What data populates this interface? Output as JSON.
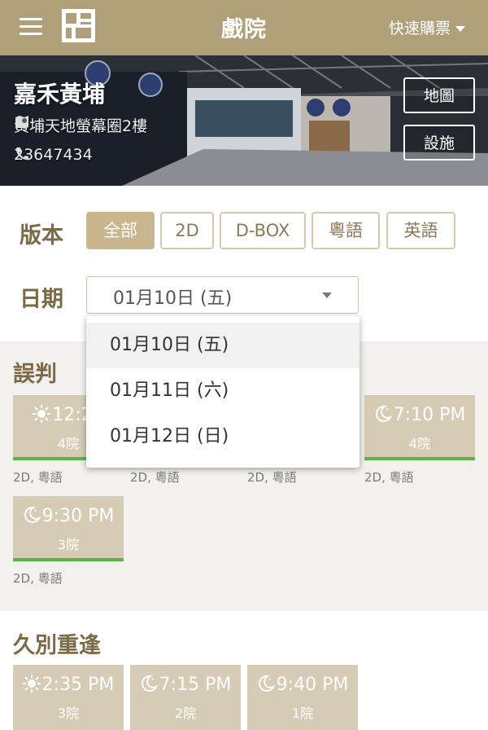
{
  "header": {
    "title": "戲院",
    "quick_buy": "快速購票"
  },
  "cinema": {
    "name": "嘉禾黃埔",
    "address": "黃埔天地螢幕圈2樓",
    "phone": "23647434",
    "map_button": "地圖",
    "facilities_button": "設施"
  },
  "filters": {
    "version_label": "版本",
    "versions": [
      "全部",
      "2D",
      "D-BOX",
      "粵語",
      "英語"
    ],
    "active_version": "全部",
    "date_label": "日期",
    "date_selected": "01月10日 (五)",
    "date_options": [
      "01月10日 (五)",
      "01月11日 (六)",
      "01月12日 (日)"
    ]
  },
  "movies": [
    {
      "title": "誤判",
      "sessions": [
        {
          "time": "12:25",
          "hall": "4院",
          "format": "2D, 粵語",
          "icon": "sun-icon"
        },
        {
          "time": "",
          "hall": "",
          "format": "2D, 粵語",
          "icon": ""
        },
        {
          "time": "",
          "hall": "",
          "format": "2D, 粵語",
          "icon": ""
        },
        {
          "time": "7:10 PM",
          "hall": "4院",
          "format": "2D, 粵語",
          "icon": "moon-icon"
        },
        {
          "time": "9:30 PM",
          "hall": "3院",
          "format": "2D, 粵語",
          "icon": "moon-icon"
        }
      ]
    },
    {
      "title": "久別重逢",
      "sessions": [
        {
          "time": "2:35 PM",
          "hall": "3院",
          "icon": "sun-icon"
        },
        {
          "time": "7:15 PM",
          "hall": "2院",
          "icon": "moon-icon"
        },
        {
          "time": "9:40 PM",
          "hall": "1院",
          "icon": "moon-icon"
        }
      ]
    }
  ],
  "colors": {
    "header_bg": "#b0a07a",
    "accent": "#c9b68e",
    "available_bar": "#5cb34a"
  }
}
